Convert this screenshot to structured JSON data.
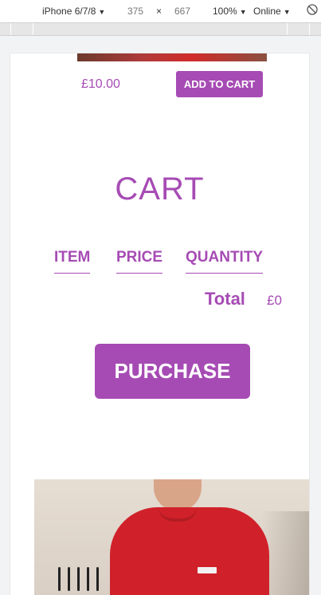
{
  "devtools": {
    "device": "iPhone 6/7/8",
    "width": "375",
    "times": "×",
    "height": "667",
    "zoom": "100%",
    "network": "Online",
    "rotate_icon": "rotate-icon"
  },
  "product": {
    "price": "£10.00",
    "add_to_cart": "ADD TO CART"
  },
  "cart": {
    "title": "CART",
    "columns": [
      "ITEM",
      "PRICE",
      "QUANTITY"
    ],
    "total_label": "Total",
    "total_value": "£0",
    "purchase": "PURCHASE"
  },
  "colors": {
    "accent": "#a64bb4"
  }
}
